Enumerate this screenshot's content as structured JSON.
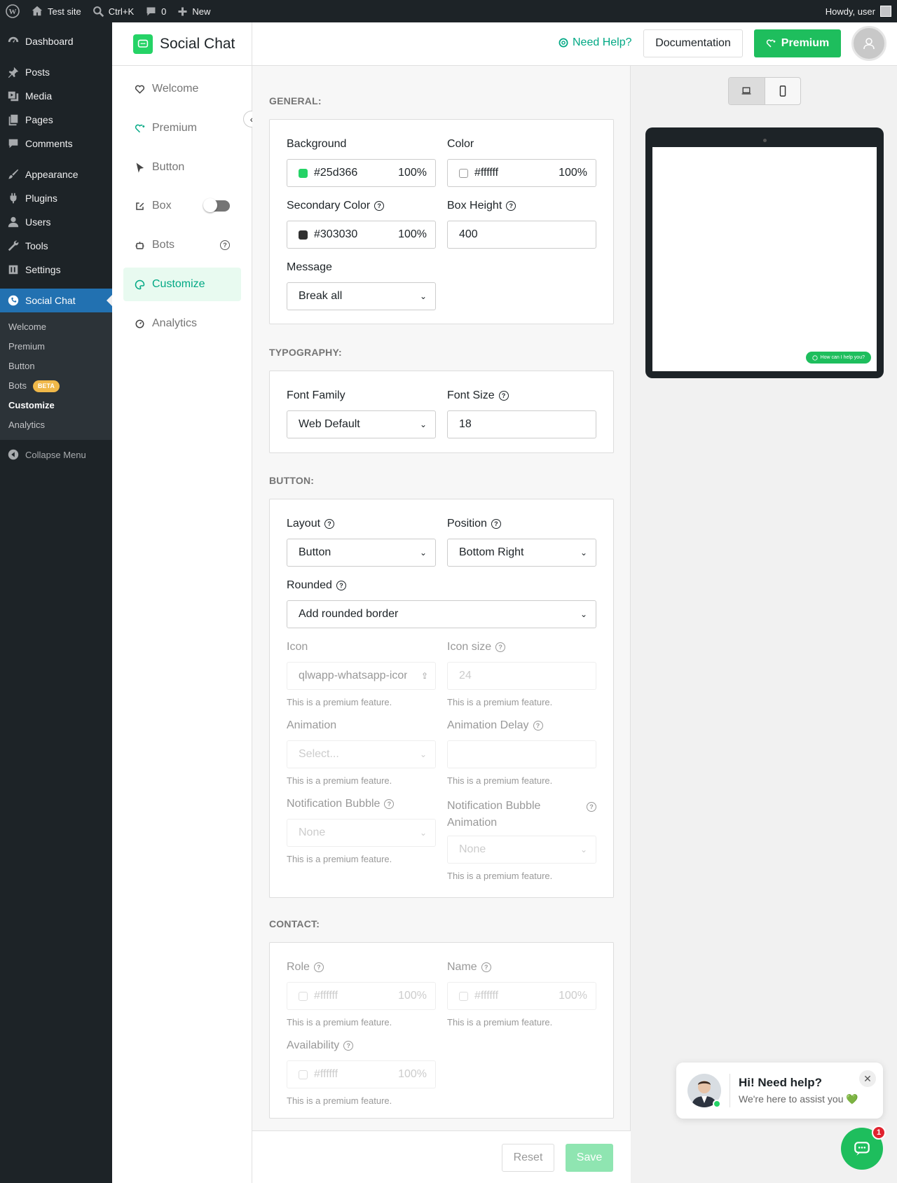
{
  "admin_bar": {
    "site_name": "Test site",
    "search_shortcut": "Ctrl+K",
    "comments_count": "0",
    "new_label": "New",
    "greeting": "Howdy, user"
  },
  "wp_menu": {
    "items": [
      {
        "label": "Dashboard",
        "icon": "dashboard-icon"
      },
      {
        "label": "Posts",
        "icon": "pin-icon"
      },
      {
        "label": "Media",
        "icon": "media-icon"
      },
      {
        "label": "Pages",
        "icon": "pages-icon"
      },
      {
        "label": "Comments",
        "icon": "comment-icon"
      },
      {
        "label": "Appearance",
        "icon": "brush-icon"
      },
      {
        "label": "Plugins",
        "icon": "plugin-icon"
      },
      {
        "label": "Users",
        "icon": "user-icon"
      },
      {
        "label": "Tools",
        "icon": "wrench-icon"
      },
      {
        "label": "Settings",
        "icon": "settings-icon"
      }
    ],
    "active": "Social Chat",
    "submenu": [
      "Welcome",
      "Premium",
      "Button",
      "Bots",
      "Customize",
      "Analytics"
    ],
    "bots_badge": "BETA",
    "collapse": "Collapse Menu"
  },
  "plugin": {
    "title": "Social Chat",
    "nav": [
      {
        "label": "Welcome",
        "icon": "heart-icon"
      },
      {
        "label": "Premium",
        "icon": "heart-plus-icon"
      },
      {
        "label": "Button",
        "icon": "cursor-icon"
      },
      {
        "label": "Box",
        "icon": "edit-box-icon"
      },
      {
        "label": "Bots",
        "icon": "robot-icon"
      },
      {
        "label": "Customize",
        "icon": "palette-icon"
      },
      {
        "label": "Analytics",
        "icon": "gauge-icon"
      }
    ],
    "active_nav": "Customize"
  },
  "topbar": {
    "help": "Need Help?",
    "documentation": "Documentation",
    "premium": "Premium"
  },
  "general": {
    "heading": "GENERAL:",
    "background": {
      "label": "Background",
      "value": "#25d366",
      "opacity": "100%",
      "swatch": "#25d366"
    },
    "color": {
      "label": "Color",
      "value": "#ffffff",
      "opacity": "100%",
      "swatch": "#ffffff"
    },
    "secondary": {
      "label": "Secondary Color",
      "value": "#303030",
      "opacity": "100%",
      "swatch": "#303030"
    },
    "box_height": {
      "label": "Box Height",
      "value": "400"
    },
    "message": {
      "label": "Message",
      "value": "Break all"
    }
  },
  "typography": {
    "heading": "TYPOGRAPHY:",
    "font_family": {
      "label": "Font Family",
      "value": "Web Default"
    },
    "font_size": {
      "label": "Font Size",
      "value": "18"
    }
  },
  "button": {
    "heading": "BUTTON:",
    "layout": {
      "label": "Layout",
      "value": "Button"
    },
    "position": {
      "label": "Position",
      "value": "Bottom Right"
    },
    "rounded": {
      "label": "Rounded",
      "value": "Add rounded border"
    },
    "icon": {
      "label": "Icon",
      "value": "qlwapp-whatsapp-icon"
    },
    "icon_size": {
      "label": "Icon size",
      "placeholder": "24"
    },
    "animation": {
      "label": "Animation",
      "placeholder": "Select..."
    },
    "animation_delay": {
      "label": "Animation Delay"
    },
    "notification_bubble": {
      "label": "Notification Bubble",
      "value": "None"
    },
    "notification_bubble_animation": {
      "label": "Notification Bubble Animation",
      "value": "None"
    },
    "premium_note": "This is a premium feature."
  },
  "contact": {
    "heading": "CONTACT:",
    "role": {
      "label": "Role",
      "value": "#ffffff",
      "opacity": "100%"
    },
    "name": {
      "label": "Name",
      "value": "#ffffff",
      "opacity": "100%"
    },
    "availability": {
      "label": "Availability",
      "value": "#ffffff",
      "opacity": "100%"
    }
  },
  "footer": {
    "reset": "Reset",
    "save": "Save"
  },
  "preview": {
    "pill_text": "How can I help you?"
  },
  "chat_widget": {
    "title": "Hi! Need help?",
    "subtitle": "We're here to assist you 💚",
    "badge": "1"
  }
}
